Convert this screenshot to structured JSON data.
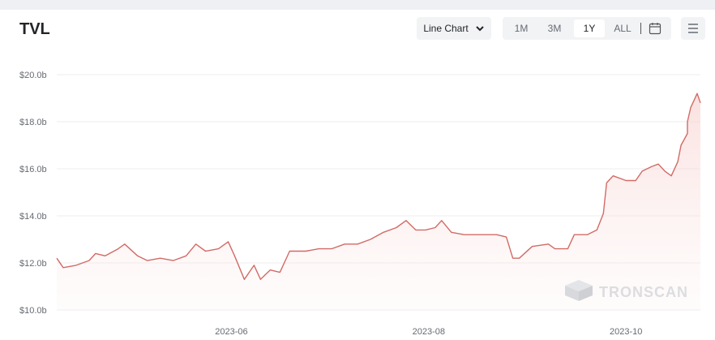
{
  "header": {
    "title": "TVL",
    "chart_type_label": "Line Chart",
    "ranges": [
      {
        "label": "1M",
        "active": false
      },
      {
        "label": "3M",
        "active": false
      },
      {
        "label": "1Y",
        "active": true
      },
      {
        "label": "ALL",
        "active": false
      }
    ]
  },
  "icons": {
    "dropdown": "chevron-down-icon",
    "calendar": "calendar-icon",
    "menu": "hamburger-menu-icon"
  },
  "watermark": {
    "text": "TRONSCAN"
  },
  "colors": {
    "line": "#d16b66",
    "fill": "#fbe9e8",
    "grid": "#eeeeee"
  },
  "chart_data": {
    "type": "area",
    "title": "TVL",
    "xlabel": "",
    "ylabel": "",
    "ylim": [
      10.0,
      20.0
    ],
    "yunit": "billion USD",
    "y_ticks": [
      "$10.0b",
      "$12.0b",
      "$14.0b",
      "$16.0b",
      "$18.0b",
      "$20.0b"
    ],
    "y_tick_values": [
      10,
      12,
      14,
      16,
      18,
      20
    ],
    "x_ticks": [
      "2023-06",
      "2023-08",
      "2023-10"
    ],
    "x_tick_dates": [
      "2023-06-01",
      "2023-08-01",
      "2023-10-01"
    ],
    "xlim": [
      "2023-04-08",
      "2023-10-24"
    ],
    "grid": true,
    "series": [
      {
        "values": [
          [
            "2023-04-08",
            12.2
          ],
          [
            "2023-04-10",
            11.8
          ],
          [
            "2023-04-14",
            11.9
          ],
          [
            "2023-04-18",
            12.1
          ],
          [
            "2023-04-20",
            12.4
          ],
          [
            "2023-04-23",
            12.3
          ],
          [
            "2023-04-27",
            12.6
          ],
          [
            "2023-04-29",
            12.8
          ],
          [
            "2023-05-03",
            12.3
          ],
          [
            "2023-05-06",
            12.1
          ],
          [
            "2023-05-10",
            12.2
          ],
          [
            "2023-05-14",
            12.1
          ],
          [
            "2023-05-18",
            12.3
          ],
          [
            "2023-05-21",
            12.8
          ],
          [
            "2023-05-24",
            12.5
          ],
          [
            "2023-05-28",
            12.6
          ],
          [
            "2023-05-31",
            12.9
          ],
          [
            "2023-06-02",
            12.3
          ],
          [
            "2023-06-05",
            11.3
          ],
          [
            "2023-06-08",
            11.9
          ],
          [
            "2023-06-10",
            11.3
          ],
          [
            "2023-06-13",
            11.7
          ],
          [
            "2023-06-16",
            11.6
          ],
          [
            "2023-06-19",
            12.5
          ],
          [
            "2023-06-24",
            12.5
          ],
          [
            "2023-06-28",
            12.6
          ],
          [
            "2023-07-02",
            12.6
          ],
          [
            "2023-07-06",
            12.8
          ],
          [
            "2023-07-10",
            12.8
          ],
          [
            "2023-07-14",
            13.0
          ],
          [
            "2023-07-18",
            13.3
          ],
          [
            "2023-07-22",
            13.5
          ],
          [
            "2023-07-25",
            13.8
          ],
          [
            "2023-07-28",
            13.4
          ],
          [
            "2023-07-31",
            13.4
          ],
          [
            "2023-08-03",
            13.5
          ],
          [
            "2023-08-05",
            13.8
          ],
          [
            "2023-08-08",
            13.3
          ],
          [
            "2023-08-12",
            13.2
          ],
          [
            "2023-08-17",
            13.2
          ],
          [
            "2023-08-22",
            13.2
          ],
          [
            "2023-08-25",
            13.1
          ],
          [
            "2023-08-27",
            12.2
          ],
          [
            "2023-08-29",
            12.2
          ],
          [
            "2023-09-02",
            12.7
          ],
          [
            "2023-09-07",
            12.8
          ],
          [
            "2023-09-09",
            12.6
          ],
          [
            "2023-09-13",
            12.6
          ],
          [
            "2023-09-15",
            13.2
          ],
          [
            "2023-09-19",
            13.2
          ],
          [
            "2023-09-22",
            13.4
          ],
          [
            "2023-09-24",
            14.1
          ],
          [
            "2023-09-25",
            15.4
          ],
          [
            "2023-09-27",
            15.7
          ],
          [
            "2023-10-01",
            15.5
          ],
          [
            "2023-10-04",
            15.5
          ],
          [
            "2023-10-06",
            15.9
          ],
          [
            "2023-10-09",
            16.1
          ],
          [
            "2023-10-11",
            16.2
          ],
          [
            "2023-10-13",
            15.9
          ],
          [
            "2023-10-15",
            15.7
          ],
          [
            "2023-10-17",
            16.3
          ],
          [
            "2023-10-18",
            17.0
          ],
          [
            "2023-10-20",
            17.5
          ],
          [
            "2023-10-20",
            18.0
          ],
          [
            "2023-10-21",
            18.6
          ],
          [
            "2023-10-22",
            18.9
          ],
          [
            "2023-10-23",
            19.2
          ],
          [
            "2023-10-24",
            18.8
          ]
        ]
      }
    ]
  }
}
